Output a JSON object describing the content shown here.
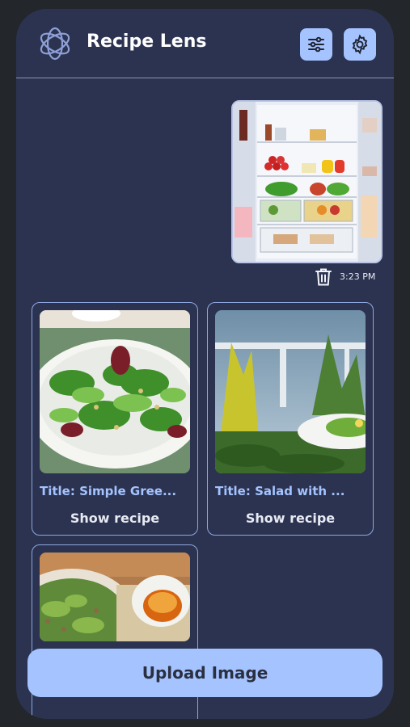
{
  "header": {
    "title": "Recipe Lens",
    "logo_icon": "openai-logo-icon",
    "filter_icon": "sliders-icon",
    "settings_icon": "gear-icon"
  },
  "chat": {
    "uploaded_image": "fridge-photo",
    "timestamp": "3:23 PM",
    "delete_icon": "trash-icon"
  },
  "recipes": [
    {
      "title": "Title: Simple Gree...",
      "action": "Show recipe",
      "image": "green-salad-photo"
    },
    {
      "title": "Title: Salad with ...",
      "action": "Show recipe",
      "image": "garden-salad-photo"
    },
    {
      "title": "",
      "action": "",
      "image": "grain-salad-with-dressing-photo"
    }
  ],
  "footer": {
    "upload_label": "Upload Image"
  },
  "colors": {
    "background": "#2c3350",
    "accent": "#a4c3ff",
    "outer": "#23262b"
  }
}
